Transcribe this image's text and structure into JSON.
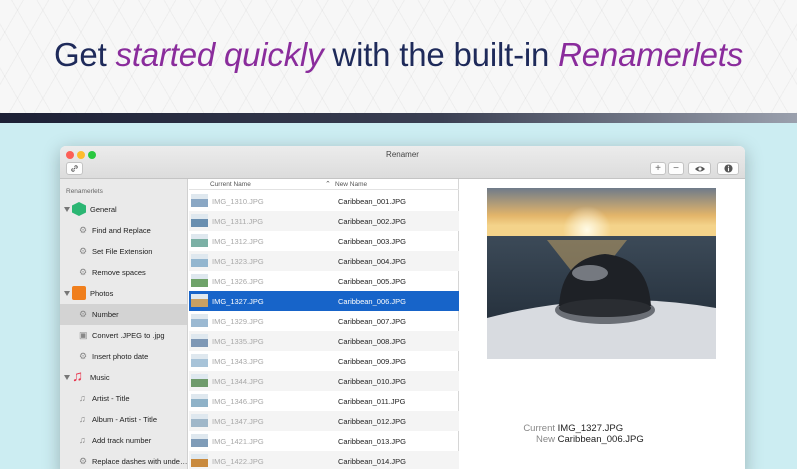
{
  "headline": {
    "part1": "Get ",
    "part2": "started quickly",
    "part3": " with the built-in ",
    "part4": "Renamerlets"
  },
  "window": {
    "title": "Renamer",
    "toolbar": {
      "link_icon": "link-icon",
      "add_label": "+",
      "remove_label": "−",
      "eye_icon": "eye-icon",
      "info_icon": "info-icon"
    }
  },
  "sidebar": {
    "heading": "Renamerlets",
    "items": [
      {
        "label": "General",
        "type": "category",
        "icon": "cube-icon",
        "color": "#2bb673"
      },
      {
        "label": "Find and Replace",
        "type": "item",
        "icon": "gear-icon"
      },
      {
        "label": "Set File Extension",
        "type": "item",
        "icon": "gear-icon"
      },
      {
        "label": "Remove spaces",
        "type": "item",
        "icon": "gear-icon"
      },
      {
        "label": "Photos",
        "type": "category",
        "icon": "photo-icon",
        "color": "#f07f1d"
      },
      {
        "label": "Number",
        "type": "item",
        "icon": "gear-icon",
        "selected": true
      },
      {
        "label": "Convert .JPEG to .jpg",
        "type": "item",
        "icon": "image-icon"
      },
      {
        "label": "Insert photo date",
        "type": "item",
        "icon": "gear-icon"
      },
      {
        "label": "Music",
        "type": "category",
        "icon": "music-note-icon",
        "color": "#e8324b"
      },
      {
        "label": "Artist - Title",
        "type": "item",
        "icon": "music-note-icon"
      },
      {
        "label": "Album - Artist - Title",
        "type": "item",
        "icon": "music-note-icon"
      },
      {
        "label": "Add track number",
        "type": "item",
        "icon": "music-note-icon"
      },
      {
        "label": "Replace dashes with unde…",
        "type": "item",
        "icon": "gear-icon"
      }
    ]
  },
  "table": {
    "headers": {
      "current": "Current Name",
      "sort_icon": "sort-up-icon",
      "new": "New Name"
    },
    "rows": [
      {
        "current": "IMG_1310.JPG",
        "new": "Caribbean_001.JPG",
        "thumb": "#8aa7c4"
      },
      {
        "current": "IMG_1311.JPG",
        "new": "Caribbean_002.JPG",
        "thumb": "#6a8fb0"
      },
      {
        "current": "IMG_1312.JPG",
        "new": "Caribbean_003.JPG",
        "thumb": "#7bb0a5"
      },
      {
        "current": "IMG_1323.JPG",
        "new": "Caribbean_004.JPG",
        "thumb": "#93b6cf"
      },
      {
        "current": "IMG_1326.JPG",
        "new": "Caribbean_005.JPG",
        "thumb": "#6fa36a"
      },
      {
        "current": "IMG_1327.JPG",
        "new": "Caribbean_006.JPG",
        "thumb": "#c9a062",
        "selected": true
      },
      {
        "current": "IMG_1329.JPG",
        "new": "Caribbean_007.JPG",
        "thumb": "#9bb9d2"
      },
      {
        "current": "IMG_1335.JPG",
        "new": "Caribbean_008.JPG",
        "thumb": "#7e98b5"
      },
      {
        "current": "IMG_1343.JPG",
        "new": "Caribbean_009.JPG",
        "thumb": "#a7c3d8"
      },
      {
        "current": "IMG_1344.JPG",
        "new": "Caribbean_010.JPG",
        "thumb": "#6f9b6c"
      },
      {
        "current": "IMG_1346.JPG",
        "new": "Caribbean_011.JPG",
        "thumb": "#8fb2c8"
      },
      {
        "current": "IMG_1347.JPG",
        "new": "Caribbean_012.JPG",
        "thumb": "#9fb7c9"
      },
      {
        "current": "IMG_1421.JPG",
        "new": "Caribbean_013.JPG",
        "thumb": "#7f9cb8"
      },
      {
        "current": "IMG_1422.JPG",
        "new": "Caribbean_014.JPG",
        "thumb": "#c98a3e"
      }
    ]
  },
  "preview": {
    "current_label": "Current",
    "current_value": "IMG_1327.JPG",
    "new_label": "New",
    "new_value": "Caribbean_006.JPG"
  },
  "colors": {
    "selection": "#1764c9",
    "headline_text": "#1e2a5a",
    "headline_accent": "#8a2c9c"
  }
}
